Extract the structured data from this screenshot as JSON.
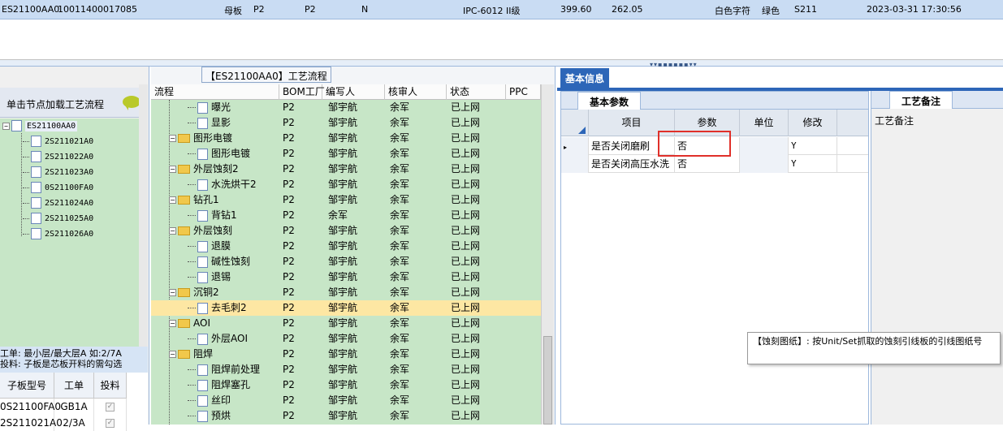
{
  "topbar": {
    "board_code": "ES21100AA0",
    "order_no": "10011400017085",
    "board_type": "母板",
    "col_a": "P2",
    "col_b": "P2",
    "col_c": "N",
    "ipc": "IPC-6012 II级",
    "dim_x": "399.60",
    "dim_y": "262.05",
    "text_color": "白色字符",
    "mask_color": "绿色",
    "ink": "S211",
    "datetime": "2023-03-31 17:30:56"
  },
  "left_panel": {
    "hint": "单击节点加载工艺流程",
    "tree_root": "ES21100AA0",
    "tree_children": [
      "2S211021A0",
      "2S211022A0",
      "2S211023A0",
      "0S21100FA0",
      "2S211024A0",
      "2S211025A0",
      "2S211026A0"
    ],
    "info_line1": "工单: 最小层/最大层A 如:2/7A",
    "info_line2": "投料: 子板是芯板开料的需勾选",
    "grid_headers": [
      "子板型号",
      "工单",
      "投料"
    ],
    "grid_rows": [
      {
        "model": "0S21100FA0",
        "order": "GB1A",
        "feed": "✓"
      },
      {
        "model": "2S211021A0",
        "order": "2/3A",
        "feed": "✓"
      }
    ]
  },
  "center_panel": {
    "title": "【ES21100AA0】工艺流程",
    "headers": [
      "流程",
      "BOM工厂",
      "编写人",
      "核审人",
      "状态",
      "PPC"
    ],
    "rows": [
      {
        "name": "曝光",
        "level": 1,
        "folder": false,
        "bom": "P2",
        "writer": "邹宇航",
        "reviewer": "余军",
        "status": "已上网"
      },
      {
        "name": "显影",
        "level": 1,
        "folder": false,
        "bom": "P2",
        "writer": "邹宇航",
        "reviewer": "余军",
        "status": "已上网"
      },
      {
        "name": "图形电镀",
        "level": 0,
        "folder": true,
        "bom": "P2",
        "writer": "邹宇航",
        "reviewer": "余军",
        "status": "已上网"
      },
      {
        "name": "图形电镀",
        "level": 1,
        "folder": false,
        "bom": "P2",
        "writer": "邹宇航",
        "reviewer": "余军",
        "status": "已上网"
      },
      {
        "name": "外层蚀刻2",
        "level": 0,
        "folder": true,
        "bom": "P2",
        "writer": "邹宇航",
        "reviewer": "余军",
        "status": "已上网"
      },
      {
        "name": "水洗烘干2",
        "level": 1,
        "folder": false,
        "bom": "P2",
        "writer": "邹宇航",
        "reviewer": "余军",
        "status": "已上网"
      },
      {
        "name": "钻孔1",
        "level": 0,
        "folder": true,
        "bom": "P2",
        "writer": "邹宇航",
        "reviewer": "余军",
        "status": "已上网"
      },
      {
        "name": "背钻1",
        "level": 1,
        "folder": false,
        "bom": "P2",
        "writer": "余军",
        "reviewer": "余军",
        "status": "已上网"
      },
      {
        "name": "外层蚀刻",
        "level": 0,
        "folder": true,
        "bom": "P2",
        "writer": "邹宇航",
        "reviewer": "余军",
        "status": "已上网"
      },
      {
        "name": "退膜",
        "level": 1,
        "folder": false,
        "bom": "P2",
        "writer": "邹宇航",
        "reviewer": "余军",
        "status": "已上网"
      },
      {
        "name": "碱性蚀刻",
        "level": 1,
        "folder": false,
        "bom": "P2",
        "writer": "邹宇航",
        "reviewer": "余军",
        "status": "已上网"
      },
      {
        "name": "退锡",
        "level": 1,
        "folder": false,
        "bom": "P2",
        "writer": "邹宇航",
        "reviewer": "余军",
        "status": "已上网"
      },
      {
        "name": "沉铜2",
        "level": 0,
        "folder": true,
        "bom": "P2",
        "writer": "邹宇航",
        "reviewer": "余军",
        "status": "已上网"
      },
      {
        "name": "去毛刺2",
        "level": 1,
        "folder": false,
        "bom": "P2",
        "writer": "邹宇航",
        "reviewer": "余军",
        "status": "已上网",
        "selected": true
      },
      {
        "name": "AOI",
        "level": 0,
        "folder": true,
        "bom": "P2",
        "writer": "邹宇航",
        "reviewer": "余军",
        "status": "已上网"
      },
      {
        "name": "外层AOI",
        "level": 1,
        "folder": false,
        "bom": "P2",
        "writer": "邹宇航",
        "reviewer": "余军",
        "status": "已上网"
      },
      {
        "name": "阻焊",
        "level": 0,
        "folder": true,
        "bom": "P2",
        "writer": "邹宇航",
        "reviewer": "余军",
        "status": "已上网"
      },
      {
        "name": "阻焊前处理",
        "level": 1,
        "folder": false,
        "bom": "P2",
        "writer": "邹宇航",
        "reviewer": "余军",
        "status": "已上网"
      },
      {
        "name": "阻焊塞孔",
        "level": 1,
        "folder": false,
        "bom": "P2",
        "writer": "邹宇航",
        "reviewer": "余军",
        "status": "已上网"
      },
      {
        "name": "丝印",
        "level": 1,
        "folder": false,
        "bom": "P2",
        "writer": "邹宇航",
        "reviewer": "余军",
        "status": "已上网"
      },
      {
        "name": "预烘",
        "level": 1,
        "folder": false,
        "bom": "P2",
        "writer": "邹宇航",
        "reviewer": "余军",
        "status": "已上网"
      }
    ]
  },
  "right_panel": {
    "tab_basic": "基本信息",
    "param_tab": "基本参数",
    "param_headers": [
      "项目",
      "参数",
      "单位",
      "修改"
    ],
    "param_rows": [
      {
        "item": "是否关闭磨刷",
        "value": "否",
        "unit": "",
        "modify": "Y",
        "current": true
      },
      {
        "item": "是否关闭高压水洗",
        "value": "否",
        "unit": "",
        "modify": "Y"
      }
    ],
    "note_tab": "工艺备注",
    "note_label": "工艺备注"
  },
  "tooltip": {
    "text": "【蚀刻图纸】: 按Unit/Set抓取的蚀刻引线板的引线图纸号"
  },
  "colors": {
    "tree_bg": "#c7e6c7",
    "selected_row": "#fde7a3",
    "tab_blue": "#2d66b8",
    "highlight_box": "#e0302a"
  }
}
